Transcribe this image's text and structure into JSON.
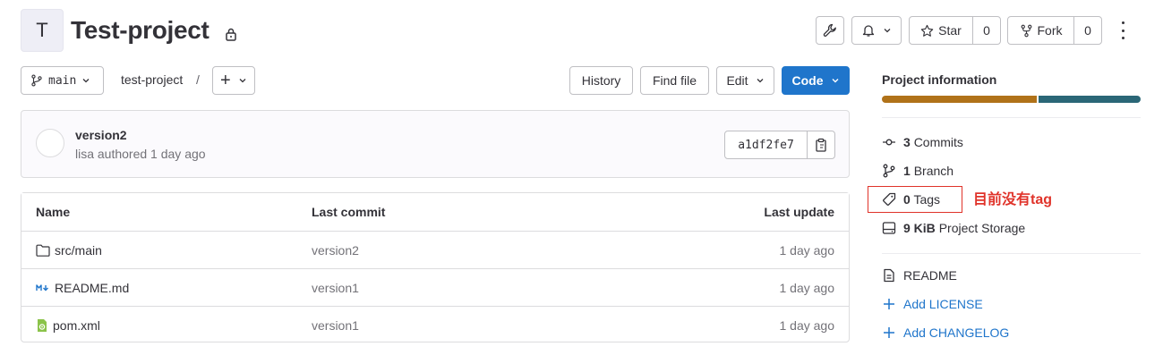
{
  "project": {
    "avatar_letter": "T",
    "name": "Test-project"
  },
  "header_actions": {
    "star_label": "Star",
    "star_count": "0",
    "fork_label": "Fork",
    "fork_count": "0"
  },
  "toolbar": {
    "branch": "main",
    "breadcrumb": "test-project",
    "breadcrumb_sep": "/",
    "add_label": "+",
    "history": "History",
    "find_file": "Find file",
    "edit": "Edit",
    "code": "Code"
  },
  "last_commit": {
    "title": "version2",
    "meta": "lisa authored 1 day ago",
    "sha": "a1df2fe7"
  },
  "files": {
    "columns": [
      "Name",
      "Last commit",
      "Last update"
    ],
    "rows": [
      {
        "name": "src/main",
        "icon": "folder-icon",
        "commit": "version2",
        "updated": "1 day ago"
      },
      {
        "name": "README.md",
        "icon": "markdown-icon",
        "commit": "version1",
        "updated": "1 day ago"
      },
      {
        "name": "pom.xml",
        "icon": "xml-file-icon",
        "commit": "version1",
        "updated": "1 day ago"
      }
    ]
  },
  "sidebar": {
    "title": "Project information",
    "language_bar": [
      {
        "color": "#b07219",
        "share": 0.6
      },
      {
        "color": "#2b6777",
        "share": 0.4
      }
    ],
    "stats": [
      {
        "icon": "commit-icon",
        "count": "3",
        "label": "Commits"
      },
      {
        "icon": "branch-icon",
        "count": "1",
        "label": "Branch"
      },
      {
        "icon": "tag-icon",
        "count": "0",
        "label": "Tags"
      },
      {
        "icon": "storage-icon",
        "count": "9 KiB",
        "label": "Project Storage"
      }
    ],
    "links": [
      {
        "icon": "document-icon",
        "label": "README"
      },
      {
        "icon": "plus-icon",
        "label": "Add LICENSE"
      },
      {
        "icon": "plus-icon",
        "label": "Add CHANGELOG"
      }
    ]
  },
  "annotation": "目前没有tag",
  "colors": {
    "primary": "#1f75cb",
    "annotation": "#e0332a"
  }
}
